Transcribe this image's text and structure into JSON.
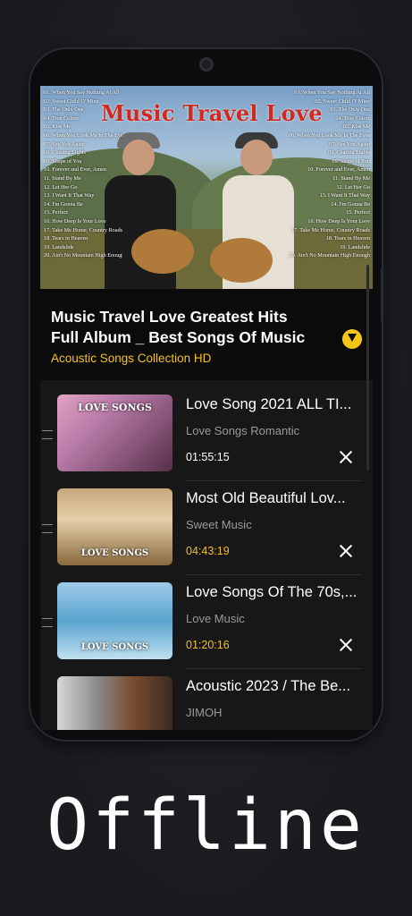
{
  "hero": {
    "title": "Music Travel Love",
    "playlist_left": [
      "01. When You Say Nothing At All",
      "02. Sweet Child O' Mine",
      "03. The Only One",
      "04. True Colors",
      "05. Kiss Me",
      "06. When You Look Me In The Eyes",
      "07. See You Again",
      "08. Chasing Lights",
      "09. Shape of You",
      "10. Forever and Ever, Amen",
      "11. Stand By Me",
      "12. Let Her Go",
      "13. I Want It That Way",
      "14. I'm Gonna Be",
      "15. Perfect",
      "16. How Deep Is Your Love",
      "17. Take Me Home, Country Roads",
      "18. Tears in Heaven",
      "19. Landslide",
      "20. Ain't No Mountain High Enough"
    ],
    "playlist_right": [
      "01. When You Say Nothing At All",
      "02. Sweet Child O' Mine",
      "03. The Only One",
      "04. True Colors",
      "05. Kiss Me",
      "06. When You Look Me In The Eyes",
      "07. See You Again",
      "08. Chasing Lights",
      "09. Shape of You",
      "10. Forever and Ever, Amen",
      "11. Stand By Me",
      "12. Let Her Go",
      "13. I Want It That Way",
      "14. I'm Gonna Be",
      "15. Perfect",
      "16. How Deep Is Your Love",
      "17. Take Me Home, Country Roads",
      "18. Tears in Heaven",
      "19. Landslide",
      "20. Ain't No Mountain High Enough"
    ]
  },
  "album": {
    "title": "Music Travel Love Greatest Hits Full Album _ Best Songs Of Music",
    "subtitle": "Acoustic Songs Collection HD"
  },
  "items": [
    {
      "title": "Love Song 2021 ALL TI...",
      "artist": "Love Songs Romantic",
      "duration": "01:55:15",
      "duration_color": "#ffffff",
      "thumb_label": "LOVE SONGS"
    },
    {
      "title": "Most Old Beautiful Lov...",
      "artist": "Sweet Music",
      "duration": "04:43:19",
      "duration_color": "#f2c21b",
      "thumb_label": "LOVE SONGS"
    },
    {
      "title": "Love Songs Of The 70s,...",
      "artist": "Love Music",
      "duration": "01:20:16",
      "duration_color": "#f2c21b",
      "thumb_label": "LOVE SONGS"
    },
    {
      "title": "Acoustic 2023 / The Be...",
      "artist": "JIMOH",
      "duration": "",
      "duration_color": "#f2c21b",
      "thumb_label": ""
    }
  ],
  "footer": {
    "label": "Offline"
  },
  "colors": {
    "accent": "#f2c21b",
    "background": "#1a1b1f"
  },
  "icons": {
    "download": "download-circle-icon",
    "remove": "close-icon",
    "drag": "drag-handle-icon"
  }
}
